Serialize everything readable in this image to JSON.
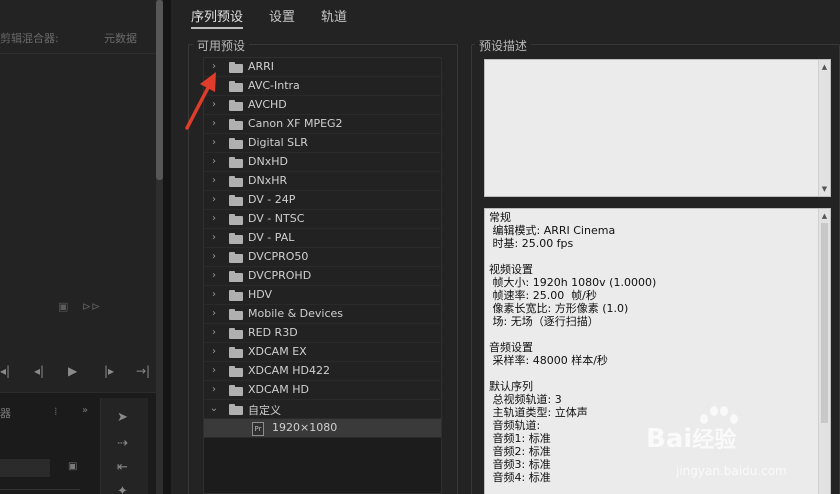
{
  "left_panel": {
    "mixer_label": "剪辑混合器:",
    "metadata_label": "元数据"
  },
  "tabs": [
    {
      "label": "序列预设",
      "active": true
    },
    {
      "label": "设置",
      "active": false
    },
    {
      "label": "轨道",
      "active": false
    }
  ],
  "available_presets": {
    "title": "可用预设",
    "folders": [
      {
        "label": "ARRI",
        "expanded": false
      },
      {
        "label": "AVC-Intra",
        "expanded": false
      },
      {
        "label": "AVCHD",
        "expanded": false
      },
      {
        "label": "Canon XF MPEG2",
        "expanded": false
      },
      {
        "label": "Digital SLR",
        "expanded": false
      },
      {
        "label": "DNxHD",
        "expanded": false
      },
      {
        "label": "DNxHR",
        "expanded": false
      },
      {
        "label": "DV - 24P",
        "expanded": false
      },
      {
        "label": "DV - NTSC",
        "expanded": false
      },
      {
        "label": "DV - PAL",
        "expanded": false
      },
      {
        "label": "DVCPRO50",
        "expanded": false
      },
      {
        "label": "DVCPROHD",
        "expanded": false
      },
      {
        "label": "HDV",
        "expanded": false
      },
      {
        "label": "Mobile & Devices",
        "expanded": false
      },
      {
        "label": "RED R3D",
        "expanded": false
      },
      {
        "label": "XDCAM EX",
        "expanded": false
      },
      {
        "label": "XDCAM HD422",
        "expanded": false
      },
      {
        "label": "XDCAM HD",
        "expanded": false
      },
      {
        "label": "自定义",
        "expanded": true
      }
    ],
    "custom_children": [
      {
        "label": "1920×1080",
        "icon_text": "Pr",
        "selected": true
      }
    ]
  },
  "preset_description": {
    "title": "预设描述",
    "details": [
      "常规",
      " 编辑模式: ARRI Cinema",
      " 时基: 25.00 fps",
      "",
      "视频设置",
      " 帧大小: 1920h 1080v (1.0000)",
      " 帧速率: 25.00  帧/秒",
      " 像素长宽比: 方形像素 (1.0)",
      " 场: 无场（逐行扫描）",
      "",
      "音频设置",
      " 采样率: 48000 样本/秒",
      "",
      "默认序列",
      " 总视频轨道: 3",
      " 主轨道类型: 立体声",
      " 音频轨道:",
      " 音频1: 标准",
      " 音频2: 标准",
      " 音频3: 标准",
      " 音频4: 标准"
    ]
  },
  "watermark": {
    "logo": "Bai",
    "logo_suffix": "经验",
    "url": "jingyan.baidu.com"
  },
  "colors": {
    "background": "#1e1e1e",
    "panel": "#232323",
    "tree_row": "#222222",
    "selected_row": "#3a3a3a",
    "description_bg": "#ebebeb",
    "annotation_arrow": "#e03c2c"
  }
}
